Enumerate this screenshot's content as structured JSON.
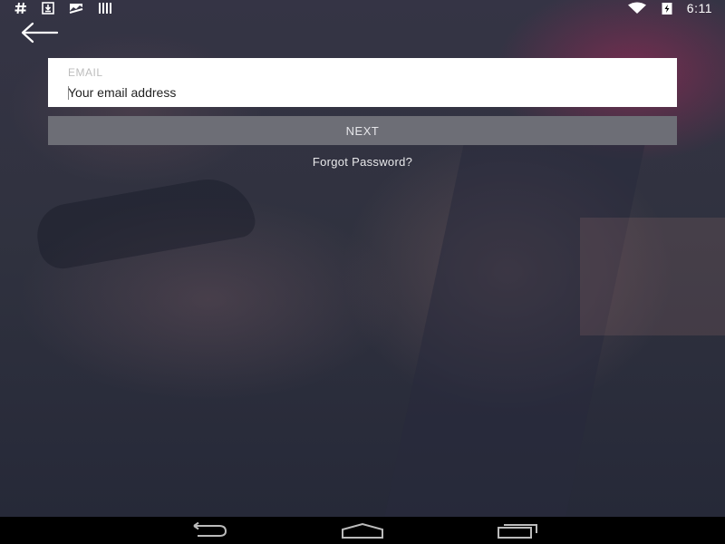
{
  "status_bar": {
    "left_icons": [
      "hashtag-icon",
      "download-icon",
      "photo-icon",
      "barcode-icon"
    ],
    "right_icons": [
      "wifi-icon",
      "battery-charging-icon"
    ],
    "time": "6:11"
  },
  "header": {
    "back_icon": "arrow-left-icon"
  },
  "form": {
    "email_label": "EMAIL",
    "email_placeholder": "Your email address",
    "email_value": "",
    "next_label": "NEXT",
    "forgot_label": "Forgot Password?"
  },
  "nav_bar": {
    "buttons": [
      "back-icon",
      "home-icon",
      "recent-apps-icon"
    ]
  },
  "colors": {
    "input_background": "#ffffff",
    "next_button_background": "#6d6e76",
    "nav_bar_background": "#000000"
  }
}
